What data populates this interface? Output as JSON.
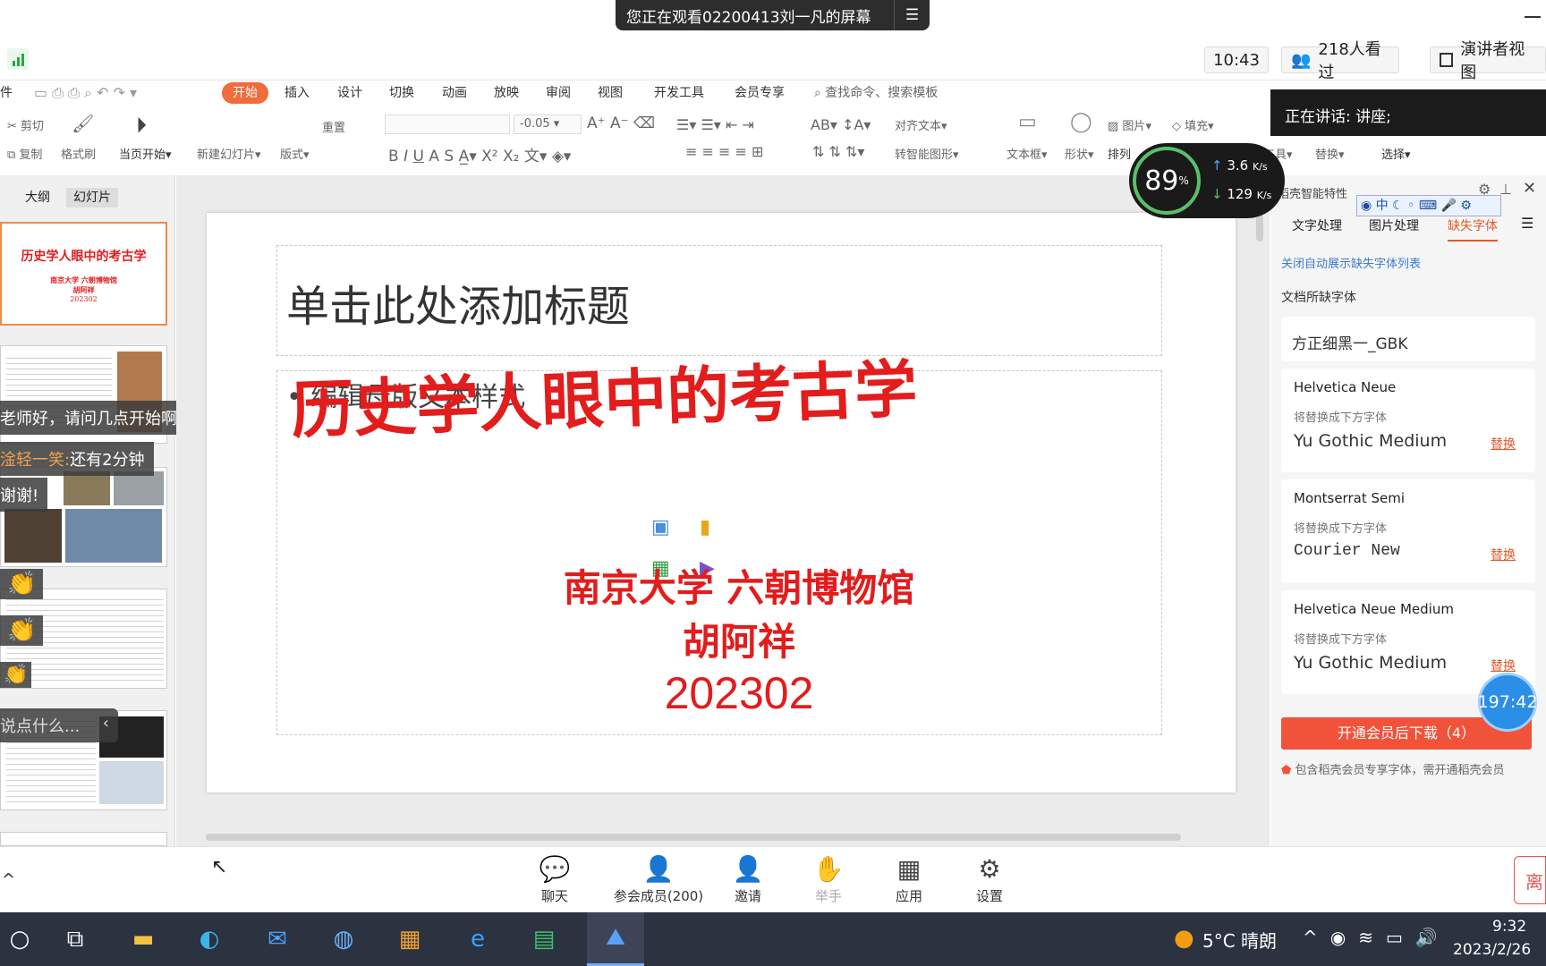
{
  "banner": {
    "text": "您正在观看02200413刘一凡的屏幕"
  },
  "meeting": {
    "time": "10:43",
    "viewers": "218人看过",
    "presenter_view": "演讲者视图"
  },
  "notice": {
    "text": "正在讲话: 讲座;"
  },
  "ribbon_tabs": [
    "件",
    "开始",
    "插入",
    "设计",
    "切换",
    "动画",
    "放映",
    "审阅",
    "视图",
    "开发工具",
    "会员专享"
  ],
  "search": {
    "placeholder": "查找命令、搜索模板"
  },
  "ribbon": {
    "cut": "剪切",
    "copy": "复制",
    "format_painter": "格式刷",
    "play_from_current": "当页开始",
    "new_slide": "新建幻灯片",
    "layout": "版式",
    "reset": "重置",
    "font_size": "-0.05",
    "align_text": "对齐文本",
    "smart_shape": "转智能图形",
    "textbox": "文本框",
    "shape": "形状",
    "arrange": "排列",
    "picture": "图片",
    "fill": "填充",
    "presentation_tools": "演示工具",
    "replace": "替换",
    "select": "选择"
  },
  "left_panel": {
    "tab_outline": "大纲",
    "tab_slides": "幻灯片",
    "thumb1": {
      "title": "历史学人眼中的考古学",
      "line1": "南京大学 六朝博物馆",
      "line2": "胡阿祥",
      "line3": "202302"
    }
  },
  "chat": [
    {
      "name": "",
      "text": "老师好，请问几点开始啊？谢谢！"
    },
    {
      "name": "淦轻一笑:",
      "text": "还有2分钟"
    },
    {
      "name": "",
      "text": "谢谢!"
    },
    {
      "name": "",
      "text": "说点什么..."
    }
  ],
  "slide": {
    "title_placeholder": "单击此处添加标题",
    "body_placeholder": "编辑母版文本样式",
    "main_title": "历史学人眼中的考古学",
    "subtitle1": "南京大学 六朝博物馆",
    "subtitle2": "胡阿祥",
    "subtitle3": "202302"
  },
  "speed": {
    "percent": "89",
    "unit": "%",
    "up": "3.6",
    "down": "129",
    "rate_unit": "K/s"
  },
  "right_panel": {
    "header": "稻壳智能特性",
    "tabs": [
      "文字处理",
      "图片处理",
      "缺失字体"
    ],
    "close_auto": "关闭自动展示缺失字体列表",
    "missing_label": "文档所缺字体",
    "missing_font": "方正细黑一_GBK",
    "replace_hint": "将替换成下方字体",
    "replace_btn": "替换",
    "fonts": [
      {
        "name": "Helvetica Neue",
        "target": "Yu Gothic Medium"
      },
      {
        "name": "Montserrat Semi",
        "target": "Courier New"
      },
      {
        "name": "Helvetica Neue Medium",
        "target": "Yu Gothic Medium"
      }
    ],
    "download_btn": "开通会员后下载（4）",
    "footnote": "包含稻壳会员专享字体，需开通稻壳会员"
  },
  "timer": "197:42",
  "bottom_bar": [
    "聊天",
    "参会成员(200)",
    "邀请",
    "举手",
    "应用",
    "设置"
  ],
  "leave_btn": "离",
  "taskbar": {
    "weather": "5°C 晴朗",
    "time": "9:32",
    "date": "2023/2/26"
  }
}
